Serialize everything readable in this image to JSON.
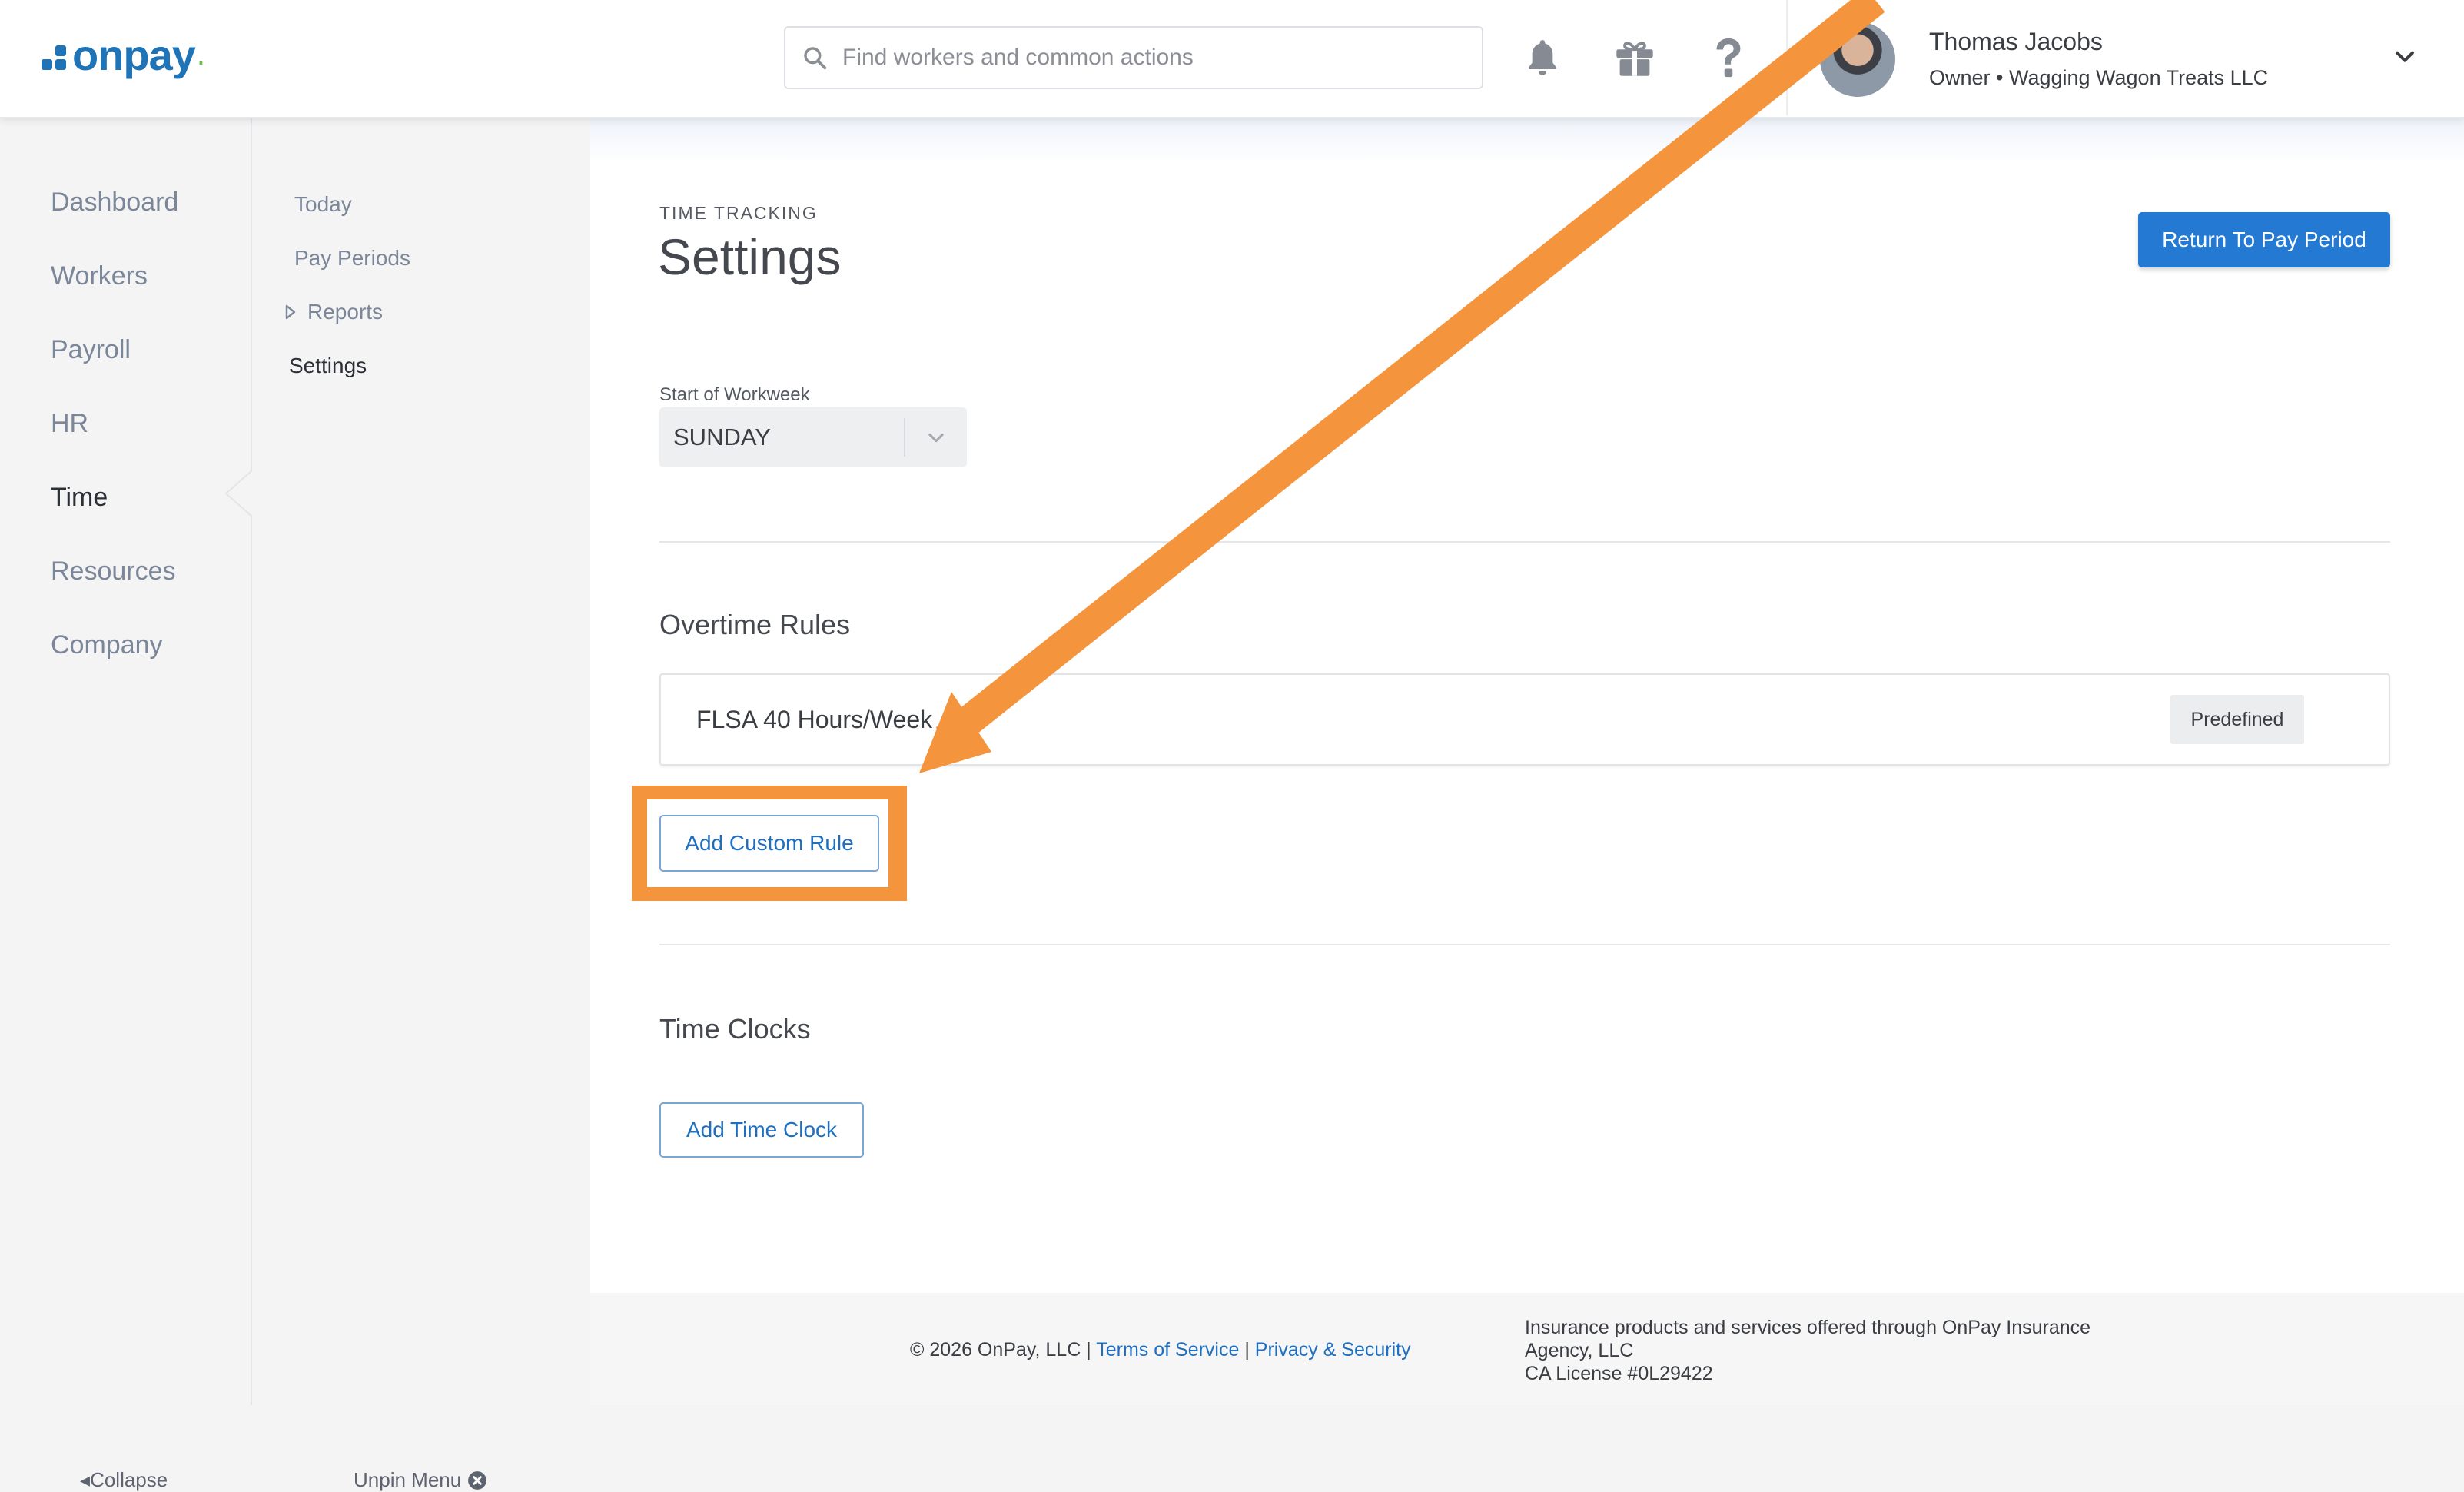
{
  "header": {
    "logo_text": "onpay",
    "search_placeholder": "Find workers and common actions",
    "user": {
      "name": "Thomas Jacobs",
      "role": "Owner • Wagging Wagon Treats LLC"
    }
  },
  "sidebar": {
    "items": [
      {
        "label": "Dashboard"
      },
      {
        "label": "Workers"
      },
      {
        "label": "Payroll"
      },
      {
        "label": "HR"
      },
      {
        "label": "Time"
      },
      {
        "label": "Resources"
      },
      {
        "label": "Company"
      }
    ],
    "active": "Time",
    "collapse_label": "Collapse"
  },
  "subnav": {
    "items": [
      {
        "label": "Today"
      },
      {
        "label": "Pay Periods"
      },
      {
        "label": "Reports"
      },
      {
        "label": "Settings"
      }
    ],
    "active": "Settings",
    "unpin_label": "Unpin Menu"
  },
  "page": {
    "section": "TIME TRACKING",
    "title": "Settings",
    "return_button": "Return To Pay Period",
    "workweek": {
      "label": "Start of Workweek",
      "value": "SUNDAY"
    },
    "overtime": {
      "heading": "Overtime Rules",
      "rules": [
        {
          "name": "FLSA 40 Hours/Week",
          "badge": "Predefined"
        }
      ],
      "add_button": "Add Custom Rule"
    },
    "time_clocks": {
      "heading": "Time Clocks",
      "add_button": "Add Time Clock"
    }
  },
  "footer": {
    "copyright": "© 2026 OnPay, LLC",
    "sep": "|",
    "terms": "Terms of Service",
    "privacy": "Privacy & Security",
    "insurance_line1": "Insurance products and services offered through OnPay Insurance",
    "insurance_line2": "Agency, LLC",
    "license": "CA License #0L29422"
  },
  "colors": {
    "brand": "#1f73b7",
    "primary_button": "#2479d3",
    "highlight": "#f4943c"
  }
}
